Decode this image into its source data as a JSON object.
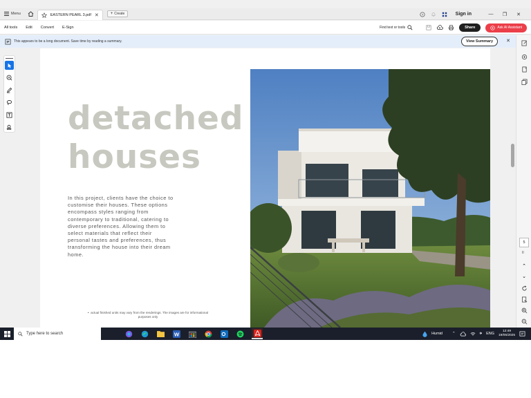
{
  "tabbar": {
    "menu_label": "Menu",
    "doc_tab_title": "EASTERN PEARL 3.pdf",
    "create_label": "Create",
    "sign_in": "Sign in"
  },
  "menubar": {
    "items": [
      "All tools",
      "Edit",
      "Convert",
      "E-Sign"
    ],
    "find_label": "Find text or tools",
    "share_label": "Share",
    "ai_label": "Ask AI Assistant"
  },
  "notification": {
    "text": "This appears to be a long document. Save time by reading a summary.",
    "button": "View Summary"
  },
  "document": {
    "headline_line1": "detached",
    "headline_line2": "houses",
    "body_lines": [
      "In this project, clients have the choice to",
      "customise their houses. These options",
      "encompass styles ranging from",
      "contemporary to traditional, catering to",
      "diverse preferences. Allowing them to",
      "select materials that reflect their",
      "personal tastes and preferences, thus",
      "transforming the house into their dream",
      "home."
    ],
    "footnote_line1": "actual finished units may vary from the renderings. The images are for informational",
    "footnote_line2": "purposes only"
  },
  "page_nav": {
    "current": "5",
    "total": "II"
  },
  "taskbar": {
    "search_placeholder": "Type here to search",
    "weather": "Humid",
    "language": "ENG",
    "time": "12:49",
    "date": "19/05/2025"
  },
  "colors": {
    "accent_blue": "#1673e6",
    "ai_red": "#eb3f4a",
    "headline_grey": "#c7c8bf",
    "taskbar": "#1a1f2b"
  }
}
